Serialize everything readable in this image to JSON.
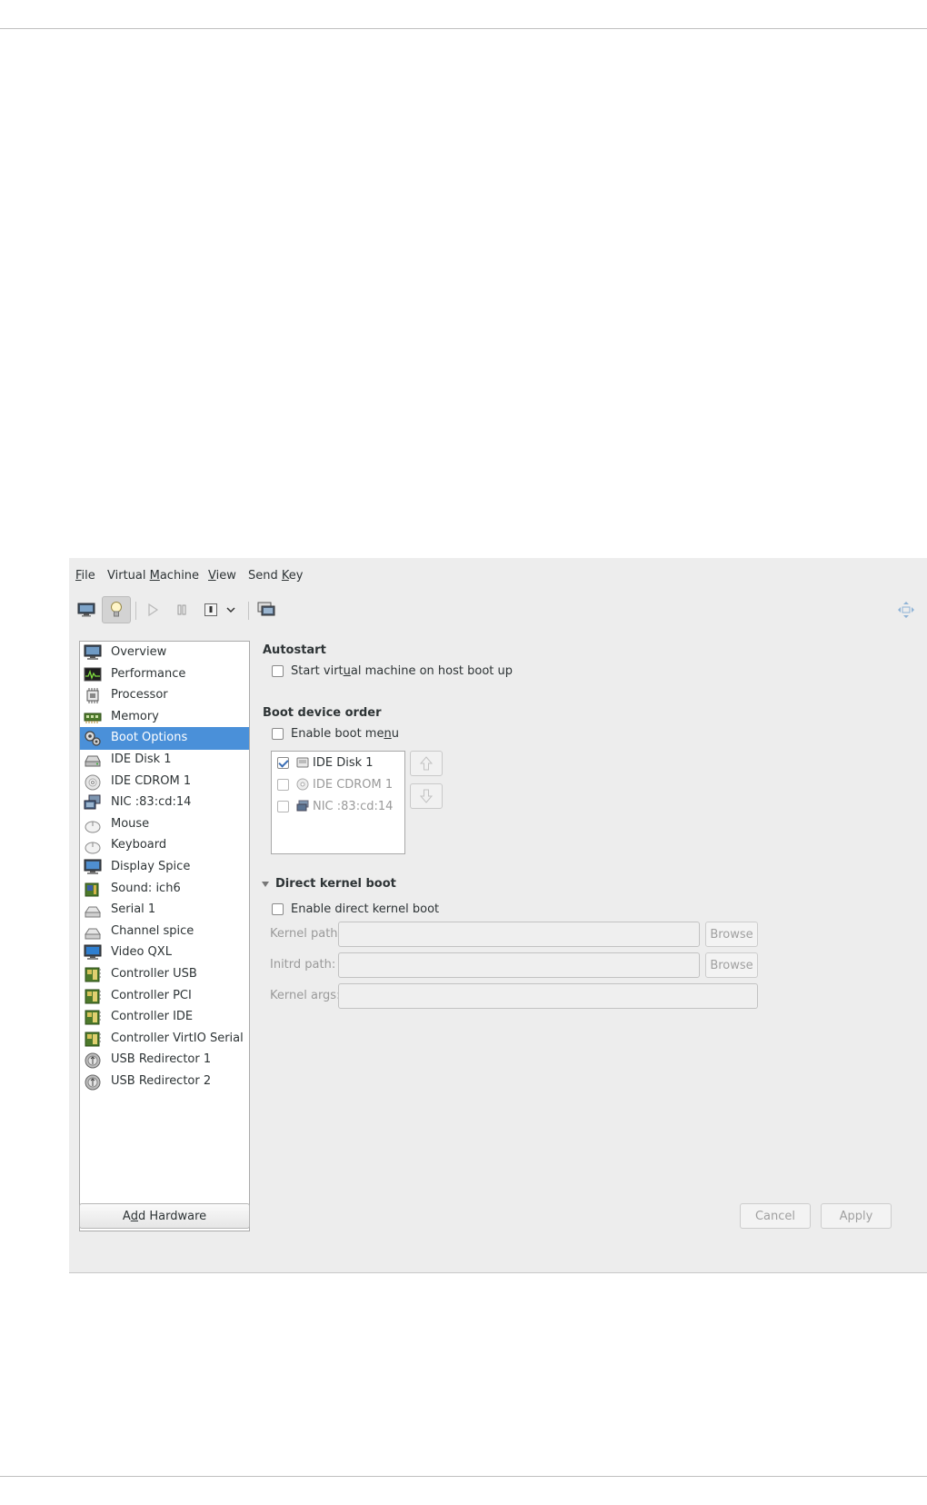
{
  "menubar": {
    "items": [
      {
        "label": "File",
        "mnemonic_prefix": "",
        "mnemonic": "F",
        "rest": "ile"
      },
      {
        "label": "Virtual Machine",
        "mnemonic_prefix": "Virtual ",
        "mnemonic": "M",
        "rest": "achine"
      },
      {
        "label": "View",
        "mnemonic_prefix": "",
        "mnemonic": "V",
        "rest": "iew"
      },
      {
        "label": "Send Key",
        "mnemonic_prefix": "Send ",
        "mnemonic": "K",
        "rest": "ey"
      }
    ]
  },
  "toolbar": {
    "icons": [
      "monitor-icon",
      "lightbulb-icon",
      "play-icon",
      "pause-icon",
      "power-icon",
      "chevron-down-icon",
      "screens-icon",
      "resize-icon"
    ],
    "active": "lightbulb-icon"
  },
  "sidebar": {
    "selected_index": 4,
    "items": [
      {
        "label": "Overview",
        "icon": "monitor-icon"
      },
      {
        "label": "Performance",
        "icon": "performance-icon"
      },
      {
        "label": "Processor",
        "icon": "processor-icon"
      },
      {
        "label": "Memory",
        "icon": "memory-icon"
      },
      {
        "label": "Boot Options",
        "icon": "boot-options-icon"
      },
      {
        "label": "IDE Disk 1",
        "icon": "disk-icon"
      },
      {
        "label": "IDE CDROM 1",
        "icon": "cdrom-icon"
      },
      {
        "label": "NIC :83:cd:14",
        "icon": "network-icon"
      },
      {
        "label": "Mouse",
        "icon": "mouse-icon"
      },
      {
        "label": "Keyboard",
        "icon": "keyboard-icon"
      },
      {
        "label": "Display Spice",
        "icon": "display-icon"
      },
      {
        "label": "Sound: ich6",
        "icon": "sound-icon"
      },
      {
        "label": "Serial 1",
        "icon": "serial-icon"
      },
      {
        "label": "Channel spice",
        "icon": "channel-icon"
      },
      {
        "label": "Video QXL",
        "icon": "video-icon"
      },
      {
        "label": "Controller USB",
        "icon": "controller-icon"
      },
      {
        "label": "Controller PCI",
        "icon": "controller-icon"
      },
      {
        "label": "Controller IDE",
        "icon": "controller-icon"
      },
      {
        "label": "Controller VirtIO Serial",
        "icon": "controller-icon"
      },
      {
        "label": "USB Redirector 1",
        "icon": "usb-redirector-icon"
      },
      {
        "label": "USB Redirector 2",
        "icon": "usb-redirector-icon"
      }
    ]
  },
  "buttons": {
    "add_hardware_prefix": "A",
    "add_hardware_mnemonic": "d",
    "add_hardware_rest": "d Hardware",
    "cancel": "Cancel",
    "apply": "Apply"
  },
  "autostart": {
    "title": "Autostart",
    "checkbox_prefix": "Start virt",
    "checkbox_mnemonic": "u",
    "checkbox_rest": "al machine on host boot up",
    "checked": false
  },
  "boot_order": {
    "title": "Boot device order",
    "menu_prefix": "Enable boot me",
    "menu_mnemonic": "n",
    "menu_rest": "u",
    "menu_checked": false,
    "devices": [
      {
        "label": "IDE Disk 1",
        "checked": true,
        "icon": "disk-icon"
      },
      {
        "label": "IDE CDROM 1",
        "checked": false,
        "icon": "cdrom-icon"
      },
      {
        "label": "NIC :83:cd:14",
        "checked": false,
        "icon": "network-icon"
      }
    ]
  },
  "direct_kernel": {
    "title": "Direct kernel boot",
    "enable_label": "Enable direct kernel boot",
    "enabled": false,
    "kernel_path_label": "Kernel path:",
    "initrd_path_label": "Initrd path:",
    "kernel_args_label": "Kernel args:",
    "kernel_path_value": "",
    "initrd_path_value": "",
    "kernel_args_value": "",
    "browse_label": "Browse"
  },
  "colors": {
    "selection": "#4a90d9",
    "window_bg": "#ededed"
  }
}
